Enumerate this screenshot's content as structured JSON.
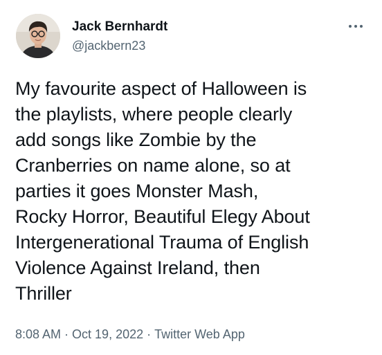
{
  "author": {
    "display_name": "Jack Bernhardt",
    "handle": "@jackbern23"
  },
  "more_icon": "more-horizontal-icon",
  "tweet": {
    "text_lines": [
      "My favourite aspect of Halloween is",
      "the playlists, where people clearly",
      "add songs like Zombie by the",
      "Cranberries on name alone, so at",
      "parties it goes Monster Mash,",
      "Rocky Horror, Beautiful Elegy About",
      "Intergenerational Trauma of English",
      "Violence Against Ireland, then",
      "Thriller"
    ]
  },
  "meta": {
    "time": "8:08 AM",
    "separator": "·",
    "date": "Oct 19, 2022",
    "source": "Twitter Web App"
  },
  "colors": {
    "text_primary": "#0f1419",
    "text_secondary": "#536471",
    "background": "#ffffff"
  }
}
